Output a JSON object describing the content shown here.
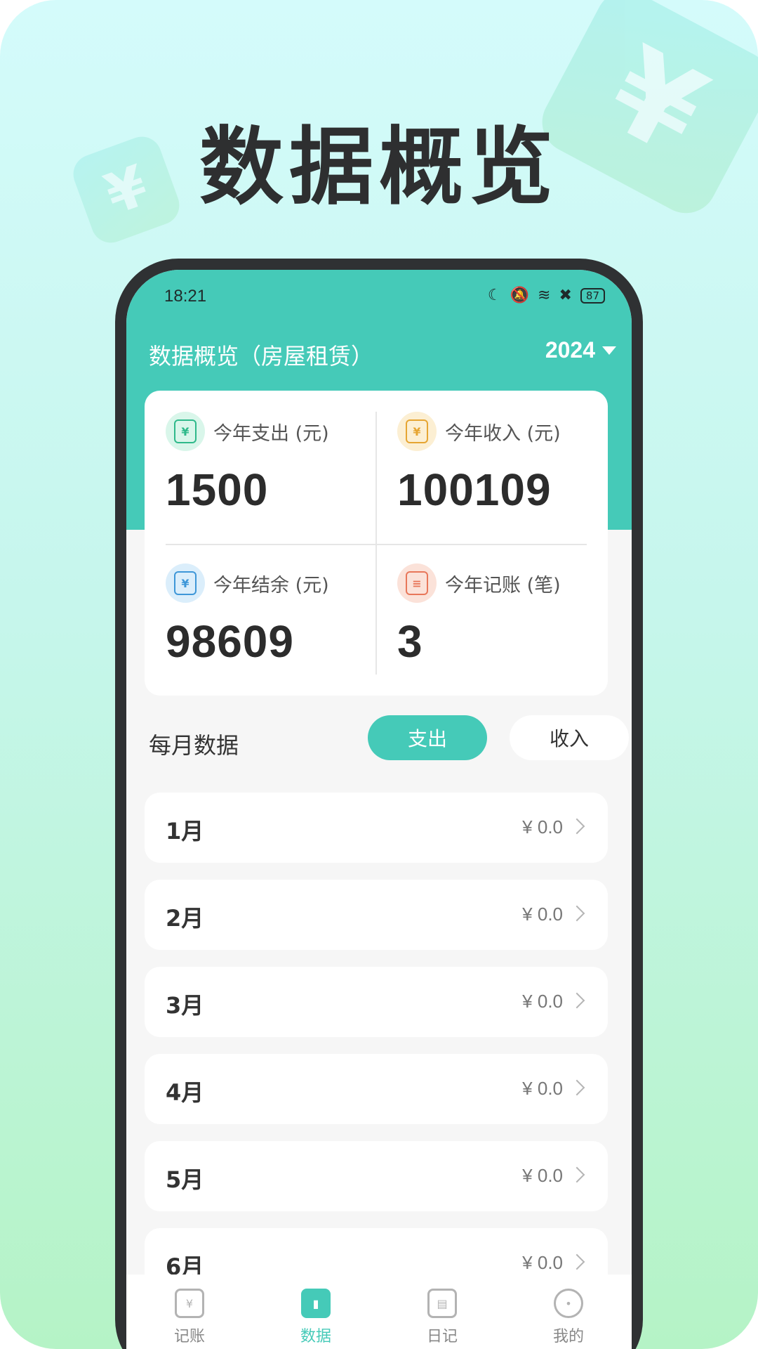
{
  "hero": {
    "title": "数据概览"
  },
  "status_bar": {
    "time": "18:21",
    "battery": "87"
  },
  "header": {
    "title": "数据概览（房屋租赁）",
    "year": "2024"
  },
  "summary": [
    {
      "label": "今年支出 (元)",
      "value": "1500",
      "icon": "expense-icon",
      "color": "#2fb98a",
      "bg": "#d9f6ea",
      "glyph": "¥"
    },
    {
      "label": "今年收入 (元)",
      "value": "100109",
      "icon": "income-bag-icon",
      "color": "#e6a532",
      "bg": "#fcefd3",
      "glyph": "¥"
    },
    {
      "label": "今年结余 (元)",
      "value": "98609",
      "icon": "balance-icon",
      "color": "#3e97d8",
      "bg": "#dbeefb",
      "glyph": "¥"
    },
    {
      "label": "今年记账 (笔)",
      "value": "3",
      "icon": "records-clipboard-icon",
      "color": "#e8775a",
      "bg": "#fbe2d9",
      "glyph": "≡"
    }
  ],
  "monthly": {
    "title": "每月数据",
    "tabs": {
      "expense": "支出",
      "income": "收入"
    },
    "rows": [
      {
        "month": "1月",
        "amount": "¥ 0.0"
      },
      {
        "month": "2月",
        "amount": "¥ 0.0"
      },
      {
        "month": "3月",
        "amount": "¥ 0.0"
      },
      {
        "month": "4月",
        "amount": "¥ 0.0"
      },
      {
        "month": "5月",
        "amount": "¥ 0.0"
      },
      {
        "month": "6月",
        "amount": "¥ 0.0"
      }
    ]
  },
  "tabbar": [
    {
      "label": "记账",
      "icon": "ledger-icon",
      "glyph": "¥"
    },
    {
      "label": "数据",
      "icon": "chart-icon",
      "glyph": "▮"
    },
    {
      "label": "日记",
      "icon": "diary-icon",
      "glyph": "▤"
    },
    {
      "label": "我的",
      "icon": "profile-face-icon",
      "glyph": "•"
    }
  ],
  "colors": {
    "accent": "#45cab8",
    "title": "#2e2f30"
  }
}
